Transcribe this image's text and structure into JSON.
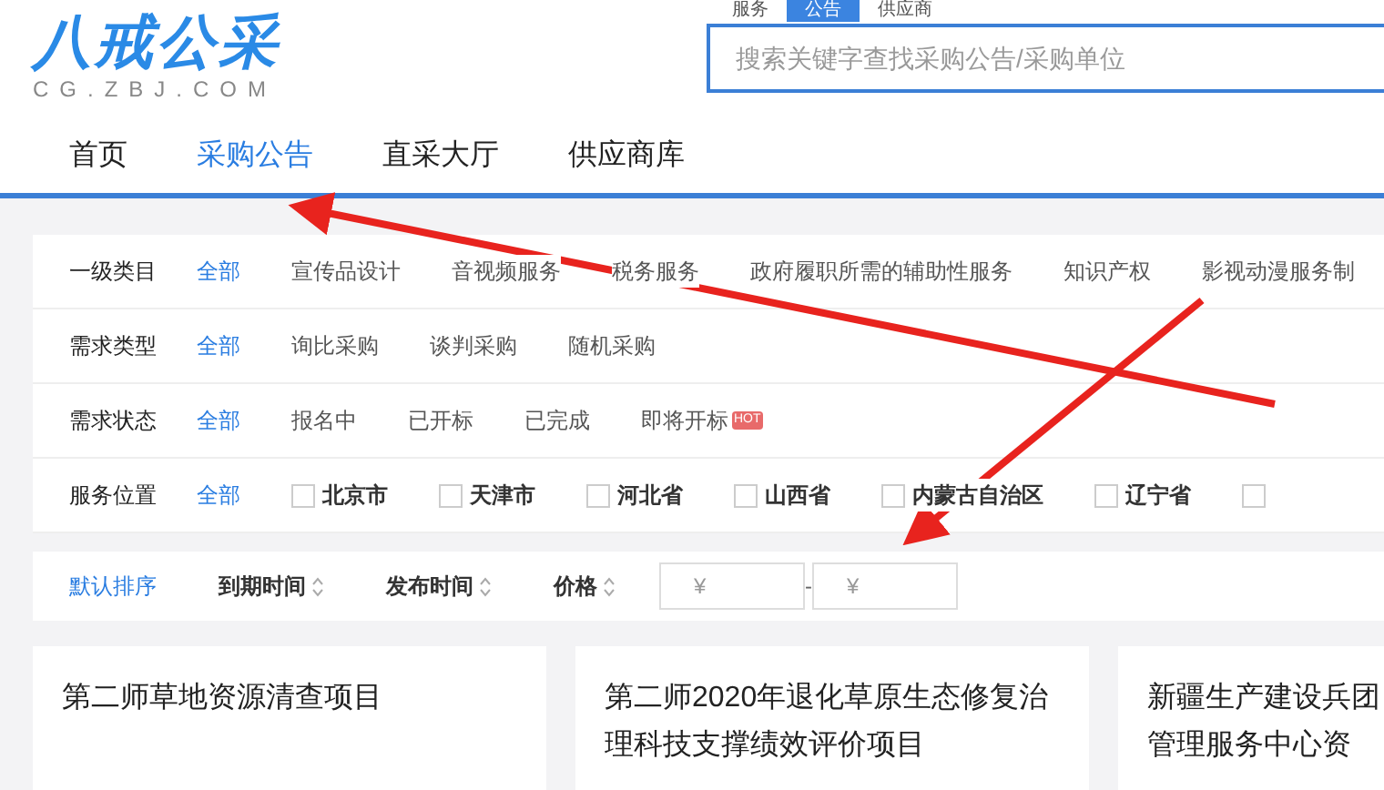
{
  "logo": {
    "name": "八戒公采",
    "domain": "CG.ZBJ.COM"
  },
  "search": {
    "tabs": [
      {
        "label": "服务",
        "selected": false
      },
      {
        "label": "公告",
        "selected": true
      },
      {
        "label": "供应商",
        "selected": false
      }
    ],
    "placeholder": "搜索关键字查找采购公告/采购单位"
  },
  "nav": [
    {
      "label": "首页",
      "selected": false
    },
    {
      "label": "采购公告",
      "selected": true
    },
    {
      "label": "直采大厅",
      "selected": false
    },
    {
      "label": "供应商库",
      "selected": false
    }
  ],
  "filters": [
    {
      "label": "一级类目",
      "kind": "text",
      "options": [
        {
          "label": "全部",
          "selected": true
        },
        {
          "label": "宣传品设计",
          "selected": false
        },
        {
          "label": "音视频服务",
          "selected": false
        },
        {
          "label": "税务服务",
          "selected": false
        },
        {
          "label": "政府履职所需的辅助性服务",
          "selected": false
        },
        {
          "label": "知识产权",
          "selected": false
        },
        {
          "label": "影视动漫服务制",
          "selected": false
        }
      ]
    },
    {
      "label": "需求类型",
      "kind": "text",
      "options": [
        {
          "label": "全部",
          "selected": true
        },
        {
          "label": "询比采购",
          "selected": false
        },
        {
          "label": "谈判采购",
          "selected": false
        },
        {
          "label": "随机采购",
          "selected": false
        }
      ]
    },
    {
      "label": "需求状态",
      "kind": "text",
      "options": [
        {
          "label": "全部",
          "selected": true
        },
        {
          "label": "报名中",
          "selected": false
        },
        {
          "label": "已开标",
          "selected": false
        },
        {
          "label": "已完成",
          "selected": false
        },
        {
          "label": "即将开标",
          "selected": false,
          "badge": "HOT"
        }
      ]
    },
    {
      "label": "服务位置",
      "kind": "checkbox",
      "options": [
        {
          "label": "全部",
          "selected": true
        },
        {
          "label": "北京市",
          "checked": false
        },
        {
          "label": "天津市",
          "checked": false
        },
        {
          "label": "河北省",
          "checked": false
        },
        {
          "label": "山西省",
          "checked": false
        },
        {
          "label": "内蒙古自治区",
          "checked": false
        },
        {
          "label": "辽宁省",
          "checked": false
        },
        {
          "checked": false
        }
      ]
    }
  ],
  "sort": [
    {
      "label": "默认排序",
      "selected": true,
      "sortable": false
    },
    {
      "label": "到期时间",
      "selected": false,
      "sortable": true
    },
    {
      "label": "发布时间",
      "selected": false,
      "sortable": true
    },
    {
      "label": "价格",
      "selected": false,
      "sortable": true
    }
  ],
  "price_range": {
    "min_placeholder": "¥",
    "max_placeholder": "¥",
    "separator": "-"
  },
  "cards": [
    {
      "title": "第二师草地资源清查项目"
    },
    {
      "title": "第二师2020年退化草原生态修复治理科技支撑绩效评价项目"
    },
    {
      "title": "新疆生产建设兵团管理服务中心资"
    }
  ]
}
